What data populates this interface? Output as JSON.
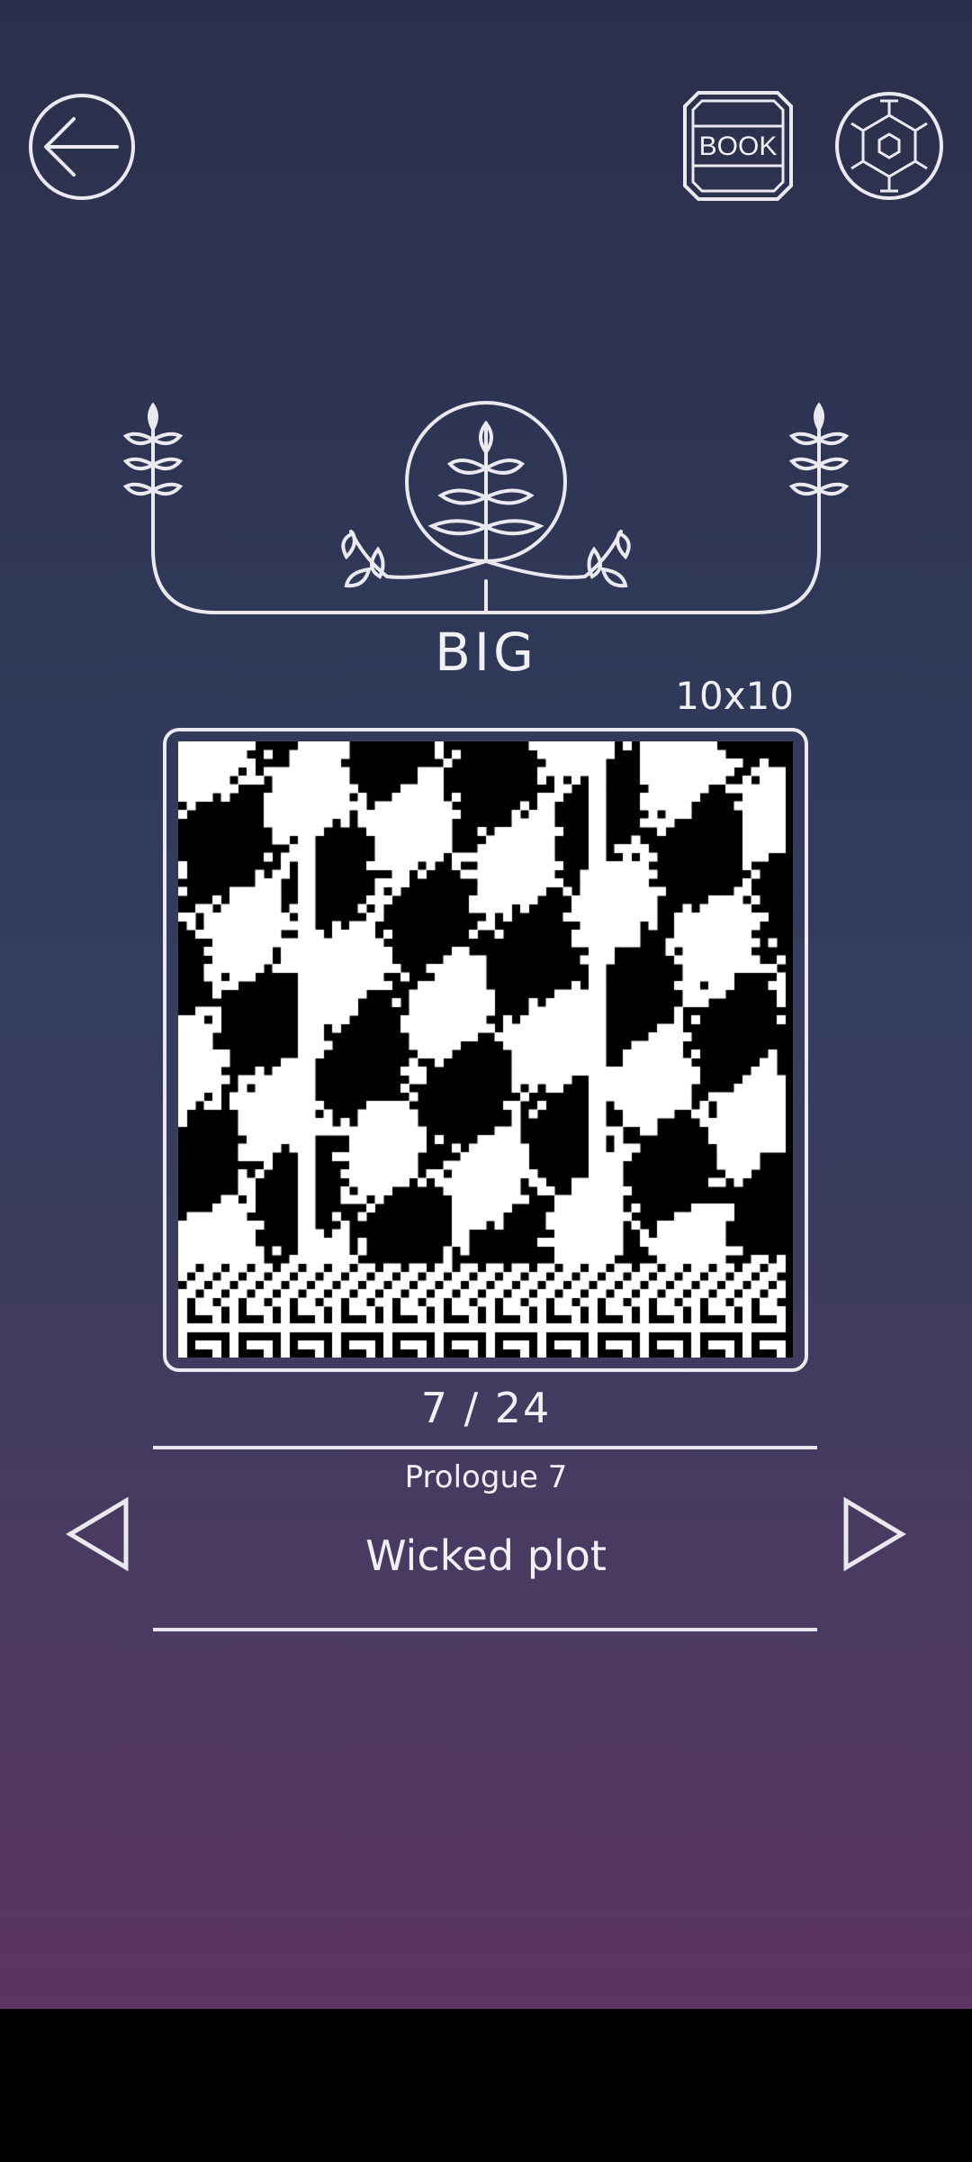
{
  "header": {
    "back_icon": "arrow-left-icon",
    "book_label": "BOOK",
    "settings_icon": "hexagon-gear-icon"
  },
  "level": {
    "category": "BIG",
    "grid_size": "10x10",
    "progress": "7 / 24",
    "chapter": "Prologue 7",
    "title": "Wicked plot"
  },
  "navigation": {
    "prev_icon": "triangle-left-icon",
    "next_icon": "triangle-right-icon"
  },
  "colors": {
    "background_top": "#2b2f4b",
    "background_bottom": "#5d3464",
    "line": "#e9e9ef",
    "text": "#f1f1f5"
  }
}
